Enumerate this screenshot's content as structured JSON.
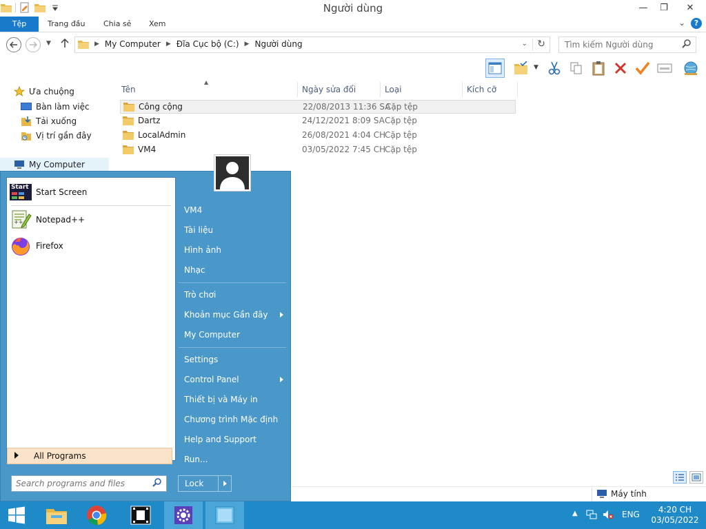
{
  "window": {
    "title": "Người dùng",
    "minimize": "—",
    "maximize": "❐",
    "close": "✕"
  },
  "ribbon": {
    "tabs": [
      "Tệp",
      "Trang đầu",
      "Chia sẻ",
      "Xem"
    ],
    "help": "?"
  },
  "address": {
    "crumbs": [
      "My Computer",
      "Đĩa Cục bộ (C:)",
      "Người dùng"
    ],
    "search_placeholder": "Tìm kiếm Người dùng"
  },
  "nav": {
    "favorites": "Ưa chuộng",
    "items": [
      "Bàn làm việc",
      "Tải xuống",
      "Vị trí gần đây"
    ],
    "computer": "My Computer"
  },
  "columns": [
    "Tên",
    "Ngày sửa đổi",
    "Loại",
    "Kích cỡ"
  ],
  "files": [
    {
      "name": "Công cộng",
      "date": "22/08/2013 11:36 SA",
      "type": "Cặp tệp"
    },
    {
      "name": "Dartz",
      "date": "24/12/2021 8:09 SA",
      "type": "Cặp tệp"
    },
    {
      "name": "LocalAdmin",
      "date": "26/08/2021 4:04 CH",
      "type": "Cặp tệp"
    },
    {
      "name": "VM4",
      "date": "03/05/2022 7:45 CH",
      "type": "Cặp tệp"
    }
  ],
  "statusbar": {
    "computer": "Máy tính"
  },
  "startmenu": {
    "pinned": [
      {
        "label": "Start Screen",
        "icon_text": "Start"
      },
      {
        "label": "Notepad++"
      },
      {
        "label": "Firefox"
      }
    ],
    "all_programs": "All Programs",
    "search_placeholder": "Search programs and files",
    "right": [
      {
        "label": "VM4"
      },
      {
        "label": "Tài liệu"
      },
      {
        "label": "Hình ảnh"
      },
      {
        "label": "Nhạc"
      },
      {
        "label": "Trò chơi"
      },
      {
        "label": "Khoản mục Gần đây"
      },
      {
        "label": "My Computer"
      },
      {
        "label": "Settings"
      },
      {
        "label": "Control Panel"
      },
      {
        "label": "Thiết bị và Máy in"
      },
      {
        "label": "Chương trình Mặc định"
      },
      {
        "label": "Help and Support"
      },
      {
        "label": "Run..."
      }
    ],
    "lock": "Lock"
  },
  "taskbar": {
    "lang": "ENG",
    "time": "4:20 CH",
    "date": "03/05/2022"
  },
  "colors": {
    "accent": "#1979ca",
    "taskbar": "#1e8ac8",
    "startmenu": "#4a98c9",
    "folder": "#e8b846"
  }
}
